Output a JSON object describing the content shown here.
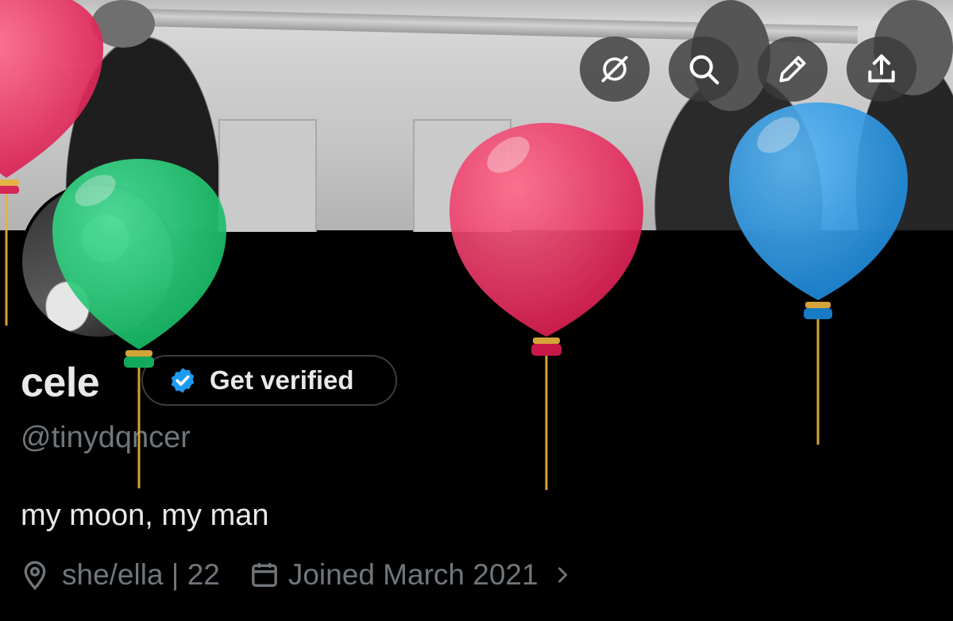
{
  "header": {
    "back_icon": "arrow-left-icon",
    "actions": [
      {
        "icon": "eye-off-icon"
      },
      {
        "icon": "search-icon"
      },
      {
        "icon": "pencil-icon"
      },
      {
        "icon": "share-icon"
      }
    ]
  },
  "profile": {
    "display_name": "cele",
    "verify_button_label": "Get verified",
    "verify_badge_icon": "verified-badge-icon",
    "handle": "@tinydqncer",
    "bio": "my moon, my man",
    "pronouns_age": "she/ella | 22",
    "joined": "Joined March 2021"
  },
  "colors": {
    "background": "#000000",
    "text_primary": "#e7e9ea",
    "text_secondary": "#71767b",
    "verified_blue": "#1d9bf0",
    "balloon_red": "#e0245e",
    "balloon_green": "#17bf63",
    "balloon_blue": "#1d9bf0"
  }
}
